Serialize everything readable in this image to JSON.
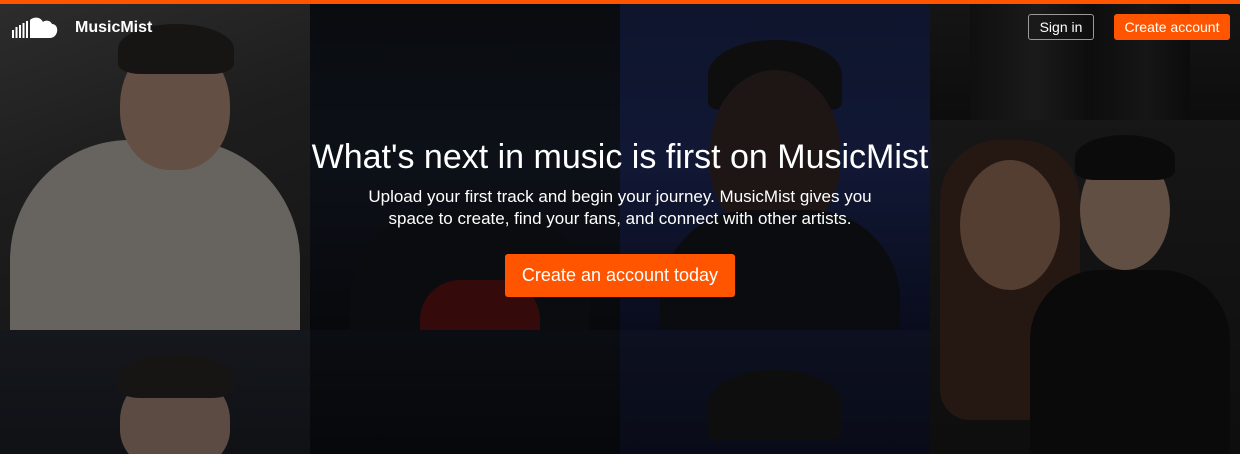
{
  "header": {
    "brand": "MusicMist",
    "logo_icon": "cloud-logo-icon",
    "sign_in_label": "Sign in",
    "create_account_label": "Create account"
  },
  "hero": {
    "title": "What's next in music is first on MusicMist",
    "subtitle": "Upload your first track and begin your journey. MusicMist gives you space to create, find your fans, and connect with other artists.",
    "cta_label": "Create an account today"
  },
  "colors": {
    "accent": "#ff5500",
    "text": "#ffffff"
  }
}
